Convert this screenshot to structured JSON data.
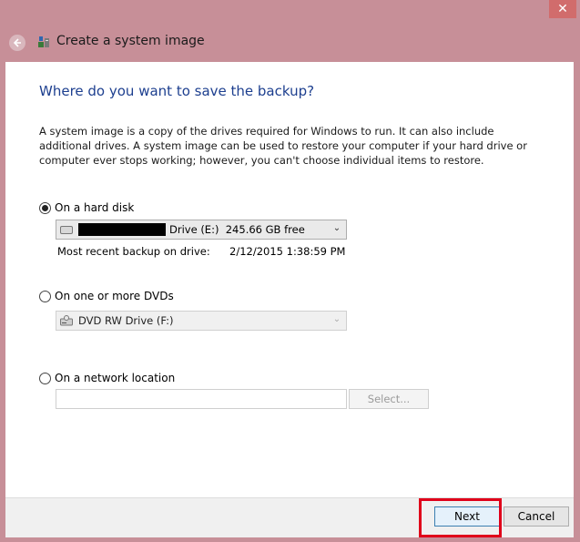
{
  "window": {
    "title": "Create a system image"
  },
  "heading": "Where do you want to save the backup?",
  "description": "A system image is a copy of the drives required for Windows to run. It can also include additional drives. A system image can be used to restore your computer if your hard drive or computer ever stops working; however, you can't choose individual items to restore.",
  "options": {
    "hard_disk": {
      "label": "On a hard disk",
      "selected": true,
      "drive_text": "Drive (E:)  245.66 GB free",
      "recent_label": "Most recent backup on drive:",
      "recent_value": "2/12/2015 1:38:59 PM"
    },
    "dvd": {
      "label": "On one or more DVDs",
      "selected": false,
      "drive_text": "DVD RW Drive (F:)"
    },
    "network": {
      "label": "On a network location",
      "selected": false,
      "location_value": "",
      "select_label": "Select..."
    }
  },
  "footer": {
    "next_label": "Next",
    "cancel_label": "Cancel"
  },
  "colors": {
    "frame": "#c78f98",
    "heading": "#1d3f8f",
    "highlight": "#e0001a"
  },
  "icons": {
    "close": "close-icon",
    "back": "back-arrow-icon",
    "app": "system-image-icon",
    "hard_drive": "hard-drive-icon",
    "dvd": "dvd-drive-icon",
    "dropdown": "chevron-down-icon"
  }
}
